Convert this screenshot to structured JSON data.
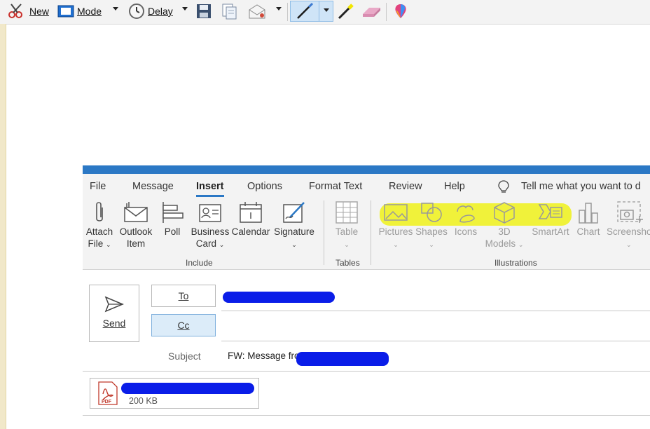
{
  "snip_toolbar": {
    "new_label": "New",
    "mode_label": "Mode",
    "delay_label": "Delay"
  },
  "outlook": {
    "tabs": [
      "File",
      "Message",
      "Insert",
      "Options",
      "Format Text",
      "Review",
      "Help"
    ],
    "active_tab": "Insert",
    "tell_me": "Tell me what you want to d",
    "include_group": {
      "label": "Include",
      "attach_file": [
        "Attach",
        "File"
      ],
      "outlook_item": [
        "Outlook",
        "Item"
      ],
      "poll": "Poll",
      "business_card": [
        "Business",
        "Card"
      ],
      "calendar": "Calendar",
      "signature": "Signature"
    },
    "tables_group": {
      "label": "Tables",
      "table": "Table"
    },
    "illustrations_group": {
      "label": "Illustrations",
      "pictures": "Pictures",
      "shapes": "Shapes",
      "icons": "Icons",
      "models": [
        "3D",
        "Models"
      ],
      "smartart": "SmartArt",
      "chart": "Chart",
      "screenshot": "Screensho"
    },
    "compose": {
      "send": "Send",
      "to": "To",
      "cc": "Cc",
      "subject_label": "Subject",
      "subject_value": "FW: Message from",
      "attachment_size": "200 KB",
      "attachment_type": "PDF"
    },
    "colors": {
      "accent": "#2b78c5",
      "highlight": "#f0f226",
      "redaction": "#0a1de8"
    }
  }
}
